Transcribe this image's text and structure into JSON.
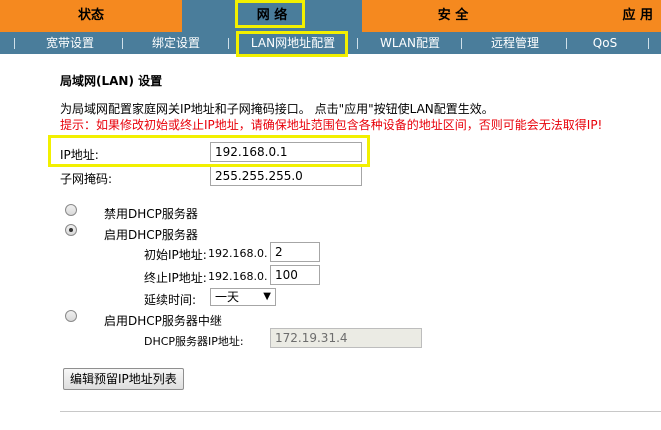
{
  "top_nav": {
    "tabs": [
      {
        "label": "状态"
      },
      {
        "label": "网 络",
        "active": true
      },
      {
        "label": "安 全"
      },
      {
        "label": "应 用"
      }
    ]
  },
  "sub_nav": {
    "items": [
      {
        "label": "宽带设置"
      },
      {
        "label": "绑定设置"
      },
      {
        "label": "LAN网地址配置",
        "active": true
      },
      {
        "label": "WLAN配置"
      },
      {
        "label": "远程管理"
      },
      {
        "label": "QoS"
      }
    ]
  },
  "page": {
    "title": "局域网(LAN) 设置",
    "description": "为局域网配置家庭网关IP地址和子网掩码接口。  点击\"应用\"按钮使LAN配置生效。",
    "warning": "提示：如果修改初始或终止IP地址，请确保地址范围包含各种设备的地址区间，否则可能会无法取得IP!"
  },
  "lan": {
    "ip_label": "IP地址:",
    "ip_value": "192.168.0.1",
    "mask_label": "子网掩码:",
    "mask_value": "255.255.255.0"
  },
  "dhcp": {
    "disable_label": "禁用DHCP服务器",
    "enable_label": "启用DHCP服务器",
    "selected": "enable",
    "start_label": "初始IP地址:",
    "start_prefix": "192.168.0.",
    "start_value": "2",
    "end_label": "终止IP地址:",
    "end_prefix": "192.168.0.",
    "end_value": "100",
    "lease_label": "延续时间:",
    "lease_value": "一天",
    "relay_label": "启用DHCP服务器中继",
    "relay_ip_label": "DHCP服务器IP地址:",
    "relay_ip_value": "172.19.31.4"
  },
  "buttons": {
    "edit_reserved": "编辑预留IP地址列表"
  },
  "colors": {
    "top_nav_bg": "#f5891f",
    "active_tab_bg": "#4a7d9b",
    "highlight": "#f2f000",
    "warning_text": "#e8000a"
  }
}
